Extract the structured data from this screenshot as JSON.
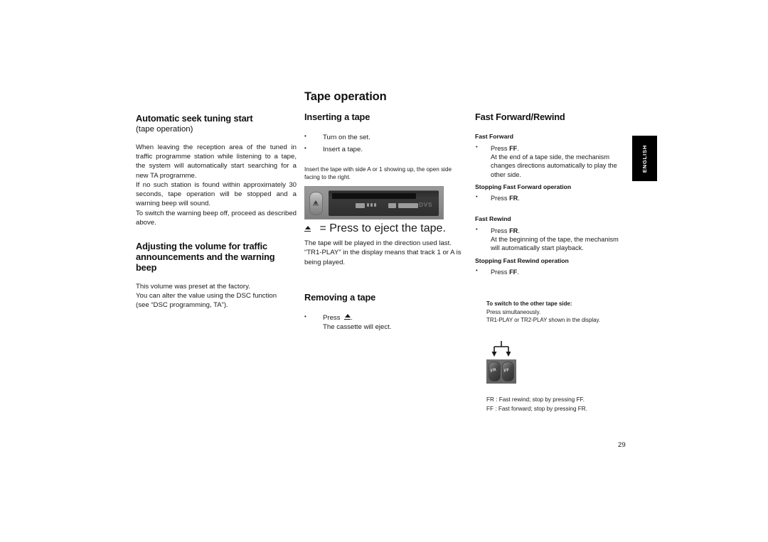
{
  "document": {
    "page_number": "29",
    "language_tab": "ENGLISH",
    "main_title": "Tape operation"
  },
  "left_column": {
    "section1": {
      "heading": "Automatic seek tuning start",
      "subtitle": "(tape operation)",
      "paragraph1": "When leaving the reception area of the tuned in traffic programme station while listening to a tape, the system will automatically start searching for a new TA programme.",
      "paragraph2": "If no such station is found within approximately 30 seconds, tape operation will be stopped and a warning beep will sound.",
      "paragraph3": "To switch the warning beep off, proceed as described above."
    },
    "section2": {
      "heading": "Adjusting the volume for traffic announcements and the warning beep",
      "paragraph1": "This volume was preset at the factory.",
      "paragraph2": "You can alter the value using the DSC function",
      "paragraph3": "(see “DSC programming, TA”)."
    }
  },
  "middle_column": {
    "section1": {
      "heading": "Inserting a tape",
      "bullets": [
        "Turn on the set.",
        "Insert a tape."
      ],
      "note": "Insert the tape with side A or 1 showing up, the open side facing to the right.",
      "deck_logo": "DVS",
      "eject_caption": "= Press to eject the tape.",
      "paragraph1": "The tape will be played in the direction used last.",
      "paragraph2": "“TR1-PLAY” in the display means that track 1 or A is being played."
    },
    "section2": {
      "heading": "Removing a tape",
      "bullet_line1": "Press",
      "bullet_line1_suffix": ".",
      "bullet_line2": "The cassette will eject."
    }
  },
  "right_column": {
    "heading": "Fast Forward/Rewind",
    "fast_forward": {
      "subheading": "Fast Forward",
      "press_prefix": "Press",
      "press_key": "FF",
      "press_suffix": ".",
      "detail": "At the end of a tape side, the mechanism changes directions automatically to play the other side."
    },
    "stopping_ff": {
      "subheading": "Stopping Fast Forward operation",
      "press_prefix": "Press",
      "press_key": "FR",
      "press_suffix": "."
    },
    "fast_rewind": {
      "subheading": "Fast Rewind",
      "press_prefix": "Press",
      "press_key": "FR",
      "press_suffix": ".",
      "detail": "At the beginning of the tape, the mechanism will automatically start playback."
    },
    "stopping_fr": {
      "subheading": "Stopping Fast Rewind operation",
      "press_prefix": "Press",
      "press_key": "FF",
      "press_suffix": "."
    },
    "switch_side": {
      "heading": "To switch to the other tape side:",
      "line1": "Press simultaneously.",
      "line2": "TR1-PLAY or TR2-PLAY shown in the display."
    },
    "button_labels": {
      "left_key": "FR",
      "right_key": "FF"
    },
    "legend": {
      "line1": "FR  :  Fast rewind; stop by pressing FF.",
      "line2": "FF  :  Fast forward; stop by pressing FR."
    }
  },
  "colors": {
    "text": "#1a1a1a",
    "tab_background": "#000000",
    "tab_text": "#ffffff"
  }
}
